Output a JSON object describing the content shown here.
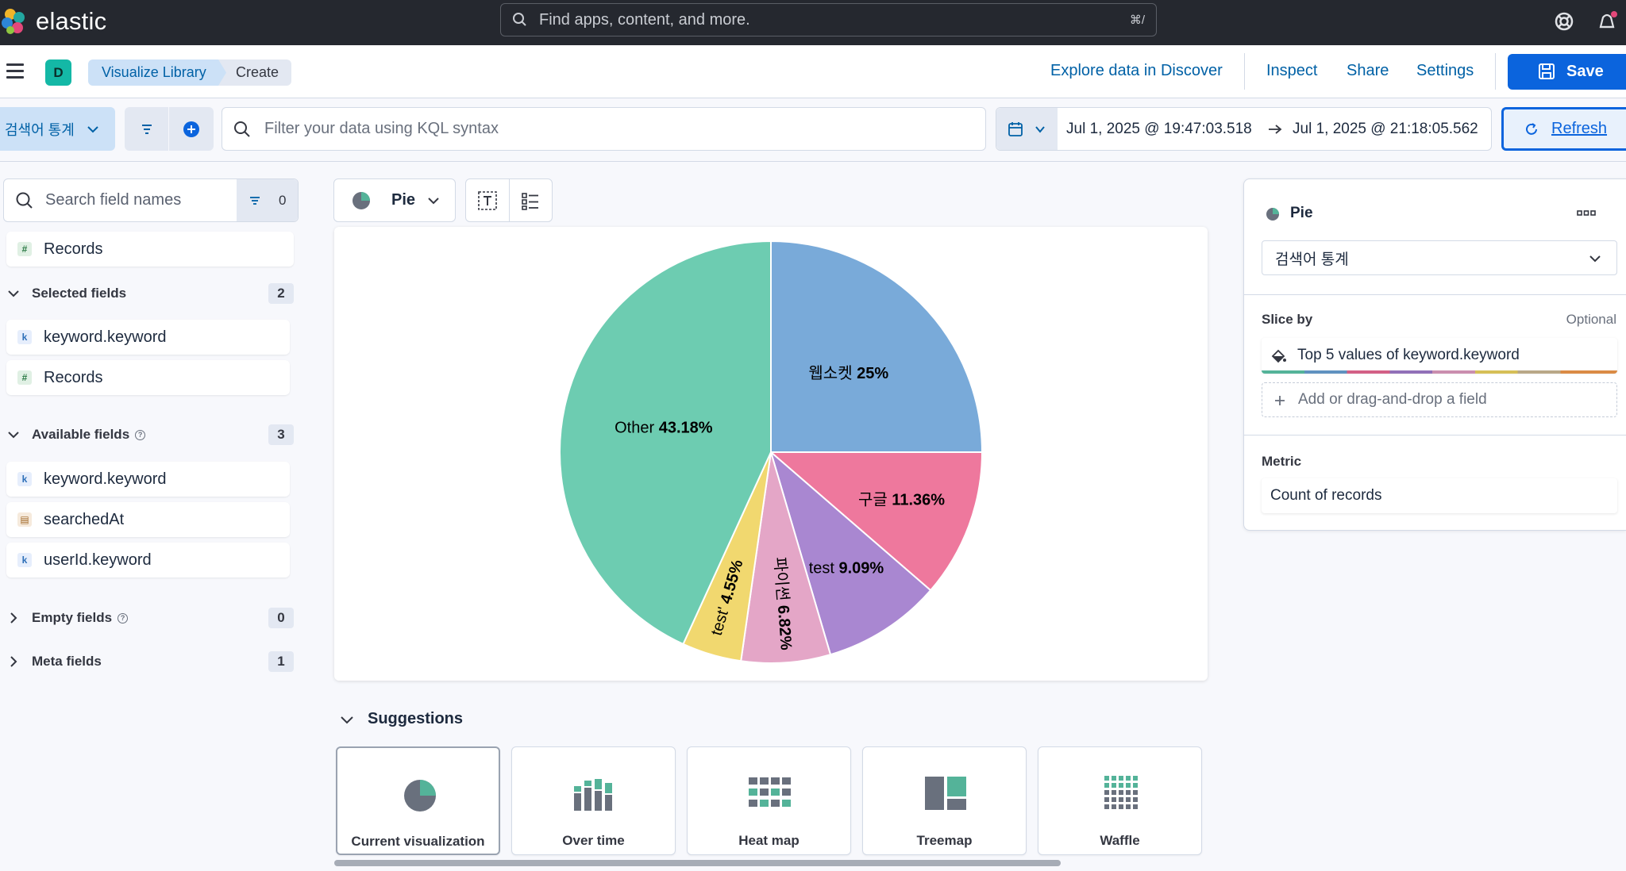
{
  "header": {
    "brand": "elastic",
    "search_placeholder": "Find apps, content, and more.",
    "search_shortcut": "⌘/"
  },
  "nav": {
    "space_initial": "D",
    "breadcrumbs": [
      "Visualize Library",
      "Create"
    ],
    "links": [
      "Explore data in Discover",
      "Inspect",
      "Share",
      "Settings"
    ],
    "save_label": "Save"
  },
  "query": {
    "data_view": "검색어 통계",
    "kql_placeholder": "Filter your data using KQL syntax",
    "date_start": "Jul 1, 2025 @ 19:47:03.518",
    "date_end": "Jul 1, 2025 @ 21:18:05.562",
    "refresh_label": "Refresh"
  },
  "fields": {
    "search_placeholder": "Search field names",
    "filter_count": "0",
    "top_field": "Records",
    "selected": {
      "label": "Selected fields",
      "count": "2",
      "items": [
        "keyword.keyword",
        "Records"
      ]
    },
    "available": {
      "label": "Available fields",
      "count": "3",
      "items": [
        "keyword.keyword",
        "searchedAt",
        "userId.keyword"
      ]
    },
    "empty": {
      "label": "Empty fields",
      "count": "0"
    },
    "meta": {
      "label": "Meta fields",
      "count": "1"
    }
  },
  "workspace": {
    "chart_type_label": "Pie"
  },
  "chart_data": {
    "type": "pie",
    "slices": [
      {
        "label": "웹소켓",
        "value": 25,
        "display": "25%",
        "color": "#79aad9"
      },
      {
        "label": "구글",
        "value": 11.36,
        "display": "11.36%",
        "color": "#ee789d"
      },
      {
        "label": "test",
        "value": 9.09,
        "display": "9.09%",
        "color": "#a987d1"
      },
      {
        "label": "파이썬",
        "value": 6.82,
        "display": "6.82%",
        "color": "#e4a6c7"
      },
      {
        "label": "test'",
        "value": 4.55,
        "display": "4.55%",
        "color": "#f1d86f"
      },
      {
        "label": "Other",
        "value": 43.18,
        "display": "43.18%",
        "color": "#6dccb1"
      }
    ]
  },
  "suggestions": {
    "title": "Suggestions",
    "items": [
      "Current visualization",
      "Over time",
      "Heat map",
      "Treemap",
      "Waffle"
    ]
  },
  "config": {
    "title": "Pie",
    "layer_data_view": "검색어 통계",
    "slice_by_label": "Slice by",
    "slice_by_optional": "Optional",
    "slice_by_value": "Top 5 values of keyword.keyword",
    "add_field": "Add or drag-and-drop a field",
    "metric_label": "Metric",
    "metric_value": "Count of records"
  }
}
